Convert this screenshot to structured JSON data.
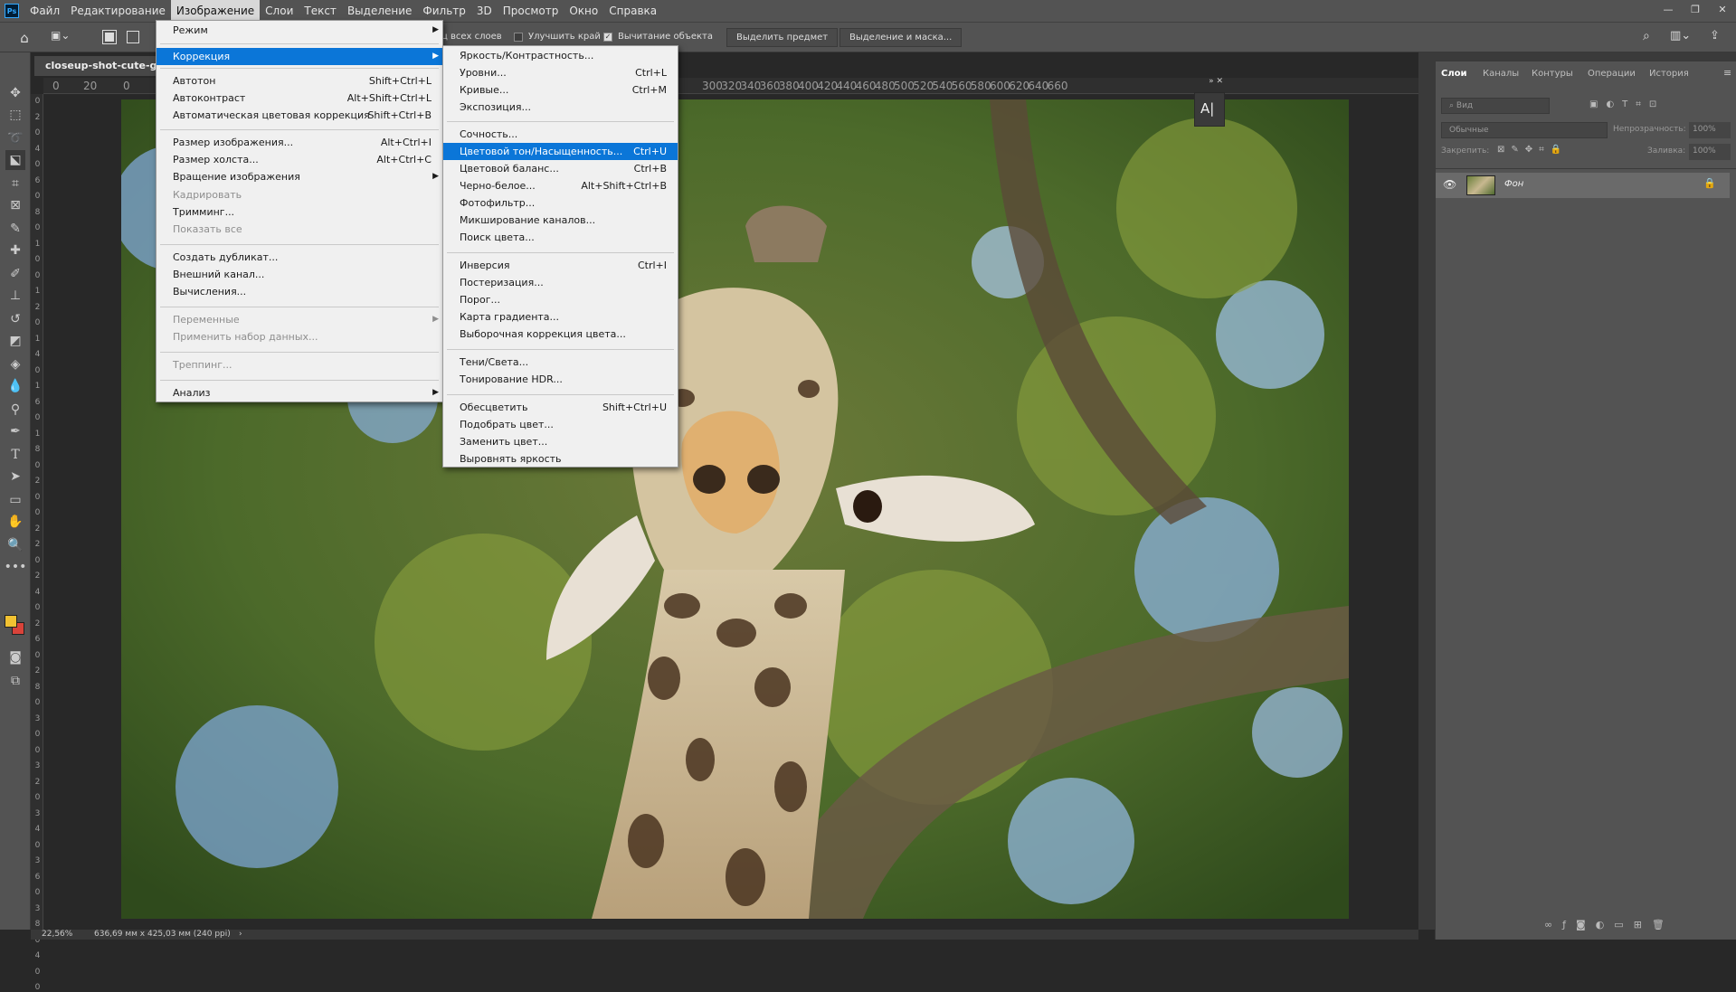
{
  "app": {
    "logo": "Ps"
  },
  "menubar": {
    "items": [
      "Файл",
      "Редактирование",
      "Изображение",
      "Слои",
      "Текст",
      "Выделение",
      "Фильтр",
      "3D",
      "Просмотр",
      "Окно",
      "Справка"
    ]
  },
  "optionsbar": {
    "sample_all_layers": "ц всех слоев",
    "enhance_edge": "Улучшить край",
    "subtract_object": "Вычитание объекта",
    "select_subject_btn": "Выделить предмет",
    "select_mask_btn": "Выделение и маска..."
  },
  "document": {
    "tab_title": "closeup-shot-cute-giraf",
    "zoom": "22,56%",
    "size_info": "636,69 мм x 425,03 мм (240 ppi)"
  },
  "ruler": {
    "h_left": [
      "0",
      "20",
      "0"
    ],
    "h_right": [
      "300",
      "320",
      "340",
      "360",
      "380",
      "400",
      "420",
      "440",
      "460",
      "480",
      "500",
      "520",
      "540",
      "560",
      "580",
      "600",
      "620",
      "640",
      "660"
    ]
  },
  "image_menu": {
    "items": [
      {
        "label": "Режим",
        "submenu": true
      },
      {
        "label": "Коррекция",
        "submenu": true,
        "highlight": true
      },
      {
        "label": "Автотон",
        "shortcut": "Shift+Ctrl+L"
      },
      {
        "label": "Автоконтраст",
        "shortcut": "Alt+Shift+Ctrl+L"
      },
      {
        "label": "Автоматическая цветовая коррекция",
        "shortcut": "Shift+Ctrl+B"
      },
      {
        "label": "Размер изображения...",
        "shortcut": "Alt+Ctrl+I"
      },
      {
        "label": "Размер холста...",
        "shortcut": "Alt+Ctrl+C"
      },
      {
        "label": "Вращение изображения",
        "submenu": true
      },
      {
        "label": "Кадрировать",
        "disabled": true
      },
      {
        "label": "Тримминг..."
      },
      {
        "label": "Показать все",
        "disabled": true
      },
      {
        "label": "Создать дубликат..."
      },
      {
        "label": "Внешний канал..."
      },
      {
        "label": "Вычисления..."
      },
      {
        "label": "Переменные",
        "submenu": true,
        "disabled": true
      },
      {
        "label": "Применить набор данных...",
        "disabled": true
      },
      {
        "label": "Треппинг...",
        "disabled": true
      },
      {
        "label": "Анализ",
        "submenu": true
      }
    ]
  },
  "adjust_menu": {
    "items": [
      {
        "label": "Яркость/Контрастность..."
      },
      {
        "label": "Уровни...",
        "shortcut": "Ctrl+L"
      },
      {
        "label": "Кривые...",
        "shortcut": "Ctrl+M"
      },
      {
        "label": "Экспозиция..."
      },
      {
        "label": "Сочность..."
      },
      {
        "label": "Цветовой тон/Насыщенность...",
        "shortcut": "Ctrl+U",
        "highlight": true
      },
      {
        "label": "Цветовой баланс...",
        "shortcut": "Ctrl+B"
      },
      {
        "label": "Черно-белое...",
        "shortcut": "Alt+Shift+Ctrl+B"
      },
      {
        "label": "Фотофильтр..."
      },
      {
        "label": "Микширование каналов..."
      },
      {
        "label": "Поиск цвета..."
      },
      {
        "label": "Инверсия",
        "shortcut": "Ctrl+I"
      },
      {
        "label": "Постеризация..."
      },
      {
        "label": "Порог..."
      },
      {
        "label": "Карта градиента..."
      },
      {
        "label": "Выборочная коррекция цвета..."
      },
      {
        "label": "Тени/Света..."
      },
      {
        "label": "Тонирование HDR..."
      },
      {
        "label": "Обесцветить",
        "shortcut": "Shift+Ctrl+U"
      },
      {
        "label": "Подобрать цвет..."
      },
      {
        "label": "Заменить цвет..."
      },
      {
        "label": "Выровнять яркость"
      }
    ]
  },
  "layers_panel": {
    "tabs": [
      "Слои",
      "Каналы",
      "Контуры",
      "Операции",
      "История"
    ],
    "search_placeholder": "Вид",
    "blend_mode": "Обычные",
    "opacity_label": "Непрозрачность:",
    "opacity_value": "100%",
    "lock_label": "Закрепить:",
    "fill_label": "Заливка:",
    "fill_value": "100%",
    "layer_name": "Фон"
  },
  "floating_panel": {
    "label": "A|"
  },
  "colors": {
    "accent": "#0b76d8",
    "foreground": "#f2c232",
    "background": "#d9433a"
  }
}
